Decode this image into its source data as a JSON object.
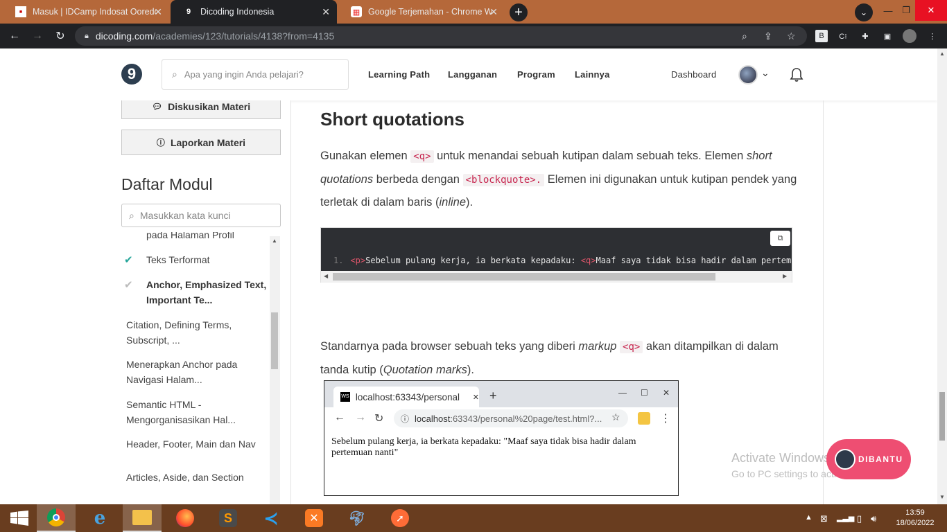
{
  "browser": {
    "tabs": [
      {
        "title": "Masuk | IDCamp Indosat Ooredoo",
        "favicon": "idcamp",
        "active": false
      },
      {
        "title": "Dicoding Indonesia",
        "favicon": "dicoding",
        "active": true
      },
      {
        "title": "Google Terjemahan - Chrome Web",
        "favicon": "chrome-store",
        "active": false
      }
    ],
    "url_host": "dicoding.com",
    "url_path": "/academies/123/tutorials/4138?from=4135"
  },
  "header": {
    "search_placeholder": "Apa yang ingin Anda pelajari?",
    "nav": [
      "Learning Path",
      "Langganan",
      "Program",
      "Lainnya"
    ],
    "dashboard": "Dashboard"
  },
  "sidebar": {
    "discuss": "Diskusikan Materi",
    "report": "Laporkan Materi",
    "title": "Daftar Modul",
    "search_placeholder": "Masukkan kata kunci",
    "modules": [
      {
        "label": "pada Halaman Profil",
        "status": "none"
      },
      {
        "label": "Teks Terformat",
        "status": "done"
      },
      {
        "label": "Anchor, Emphasized Text, Important Te...",
        "status": "current"
      },
      {
        "label": "Citation, Defining Terms, Subscript, ...",
        "status": "none"
      },
      {
        "label": "Menerapkan Anchor pada Navigasi Halam...",
        "status": "none"
      },
      {
        "label": "Semantic HTML - Mengorganisasikan Hal...",
        "status": "none"
      },
      {
        "label": "Header, Footer, Main dan Nav",
        "status": "none"
      },
      {
        "label": "Articles, Aside, dan Section",
        "status": "none"
      }
    ]
  },
  "content": {
    "heading": "Short quotations",
    "p1": {
      "a": "Gunakan elemen ",
      "code1": "<q>",
      "b": " untuk menandai sebuah kutipan dalam sebuah teks. Elemen ",
      "em1": "short quotations",
      "c": " berbeda dengan ",
      "code2": "<blockquote>.",
      "d": " Elemen ini digunakan untuk kutipan pendek yang terletak di dalam baris (",
      "em2": "inline",
      "e": ")."
    },
    "code": {
      "line_no": "1.",
      "tag_open": "<p>",
      "text1": "Sebelum pulang kerja, ia berkata kepadaku: ",
      "tag_q": "<q>",
      "text2": "Maaf saya tidak bisa hadir dalam pertemuan nanti</q></p>"
    },
    "p2": {
      "a": "Standarnya pada browser sebuah teks yang diberi ",
      "em1": "markup",
      "code1": "<q>",
      "b": " akan ditampilkan di dalam tanda kutip (",
      "em2": "Quotation marks",
      "c": ")."
    },
    "figure": {
      "tab_title": "localhost:63343/personal",
      "url_host": "localhost",
      "url_path": ":63343/personal%20page/test.html?...",
      "rendered_text": "Sebelum pulang kerja, ia berkata kepadaku: \"Maaf saya tidak bisa hadir dalam pertemuan nanti\""
    }
  },
  "overlay": {
    "watermark_title": "Activate Windows",
    "watermark_sub": "Go to PC settings to activate Windows.",
    "help_button": "DIBANTU"
  },
  "taskbar": {
    "time": "13:59",
    "date": "18/06/2022"
  },
  "colors": {
    "accent": "#2d3e50",
    "code": "#c7254e",
    "help": "#ee4e72"
  }
}
